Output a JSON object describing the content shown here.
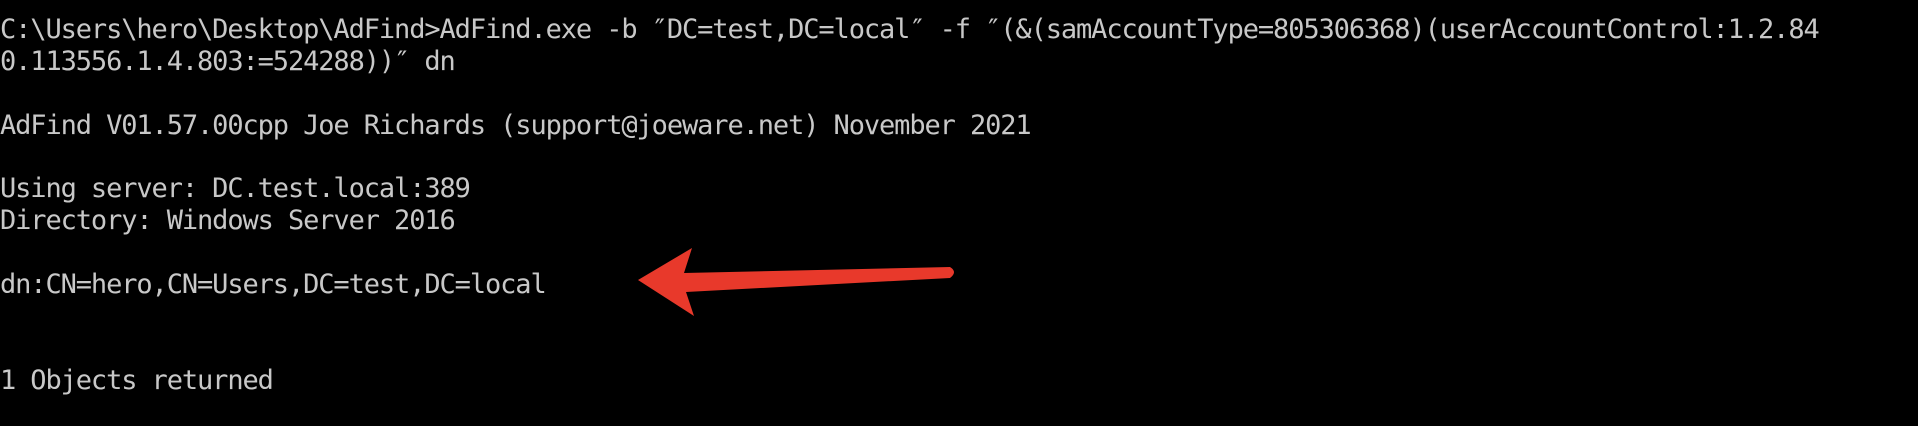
{
  "terminal": {
    "command_line_1": "C:\\Users\\hero\\Desktop\\AdFind>AdFind.exe -b ″DC=test,DC=local″ -f ″(&(samAccountType=805306368)(userAccountControl:1.2.84",
    "command_line_2": "0.113556.1.4.803:=524288))″ dn",
    "banner": "AdFind V01.57.00cpp Joe Richards (support@joeware.net) November 2021",
    "server": "Using server: DC.test.local:389",
    "directory": "Directory: Windows Server 2016",
    "dn_result": "dn:CN=hero,CN=Users,DC=test,DC=local",
    "summary": "1 Objects returned"
  },
  "annotation": {
    "icon": "arrow-left-icon",
    "color": "#e8392b"
  },
  "colors": {
    "background": "#000000",
    "text": "#c8c8c8"
  }
}
